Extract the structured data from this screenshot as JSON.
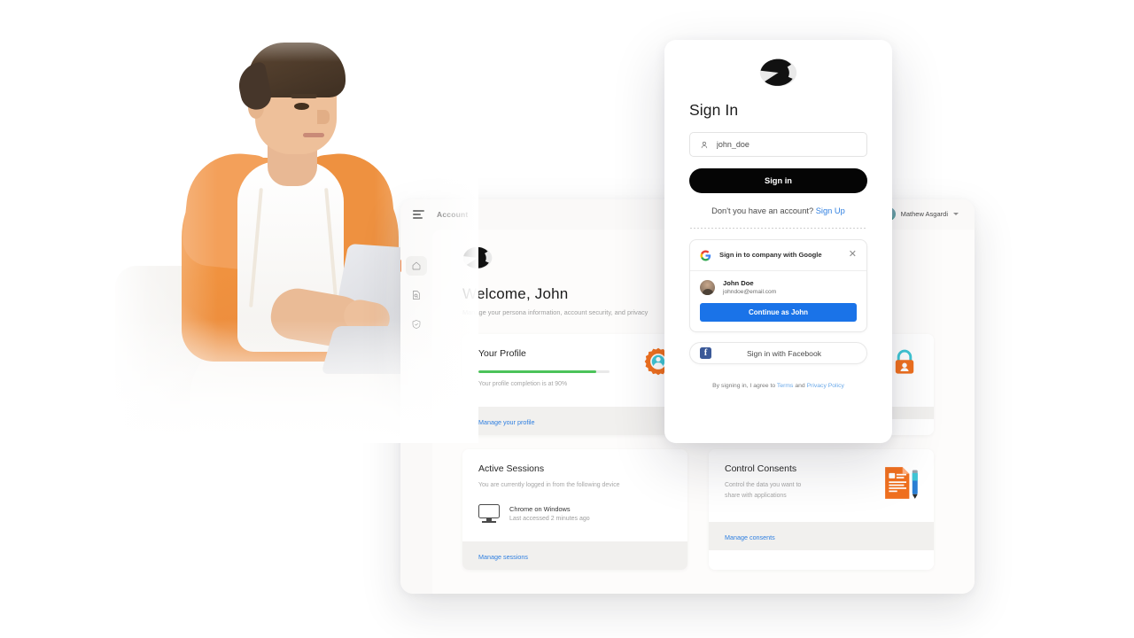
{
  "hero": {
    "alt": "young-man-orange-hoodie-with-laptop"
  },
  "dashboard": {
    "menu_icon": "hamburger-icon",
    "title": "Account",
    "user": {
      "name": "Mathew Asgardi",
      "chevron": "chevron-down-icon"
    },
    "rail": [
      {
        "name": "home",
        "icon": "home-icon",
        "active": true
      },
      {
        "name": "activity",
        "icon": "document-search-icon",
        "active": false
      },
      {
        "name": "security",
        "icon": "shield-check-icon",
        "active": false
      }
    ],
    "welcome": {
      "heading": "Welcome, John",
      "subheading": "Manage your persona information, account security, and privacy"
    },
    "cards": [
      {
        "title": "Your Profile",
        "subtitle": "Your profile completion is at 90%",
        "progress": 90,
        "progress_color": "#4cc35a",
        "icon": "gear-profile-icon",
        "link": "Manage your profile"
      },
      {
        "title": "",
        "subtitle": "",
        "icon": "lock-profile-icon",
        "link": ""
      },
      {
        "title": "Active Sessions",
        "subtitle": "You are currently logged in from the following device",
        "device_name": "Chrome on Windows",
        "device_meta": "Last accessed 2 minutes ago",
        "device_icon": "monitor-icon",
        "link": "Manage sessions"
      },
      {
        "title": "Control Consents",
        "subtitle_line1": "Control the data you want to",
        "subtitle_line2": "share with applications",
        "icon": "document-pen-icon",
        "link": "Manage consents"
      }
    ]
  },
  "modal": {
    "logo": "brand-logo",
    "heading": "Sign In",
    "username": {
      "value": "john_doe",
      "placeholder": "john_doe",
      "icon": "user-icon"
    },
    "signin_button": "Sign in",
    "no_account_text": "Don't you have an account?",
    "signup_link": "Sign Up",
    "google": {
      "icon": "google-g-icon",
      "prompt": "Sign in to company with Google",
      "close_icon": "close-icon",
      "account_name": "John Doe",
      "account_email": "johndoe@email.com",
      "continue_button": "Continue as John",
      "button_color": "#1a73e8"
    },
    "facebook": {
      "icon": "facebook-icon",
      "label": "Sign in with Facebook",
      "color": "#3b5998"
    },
    "legal": {
      "prefix": "By signing in, I agree to",
      "terms": "Terms",
      "and": "and",
      "privacy": "Privacy Policy"
    }
  },
  "colors": {
    "accent": "#f36f21",
    "link": "#2f7fe0",
    "success": "#4cc35a"
  }
}
